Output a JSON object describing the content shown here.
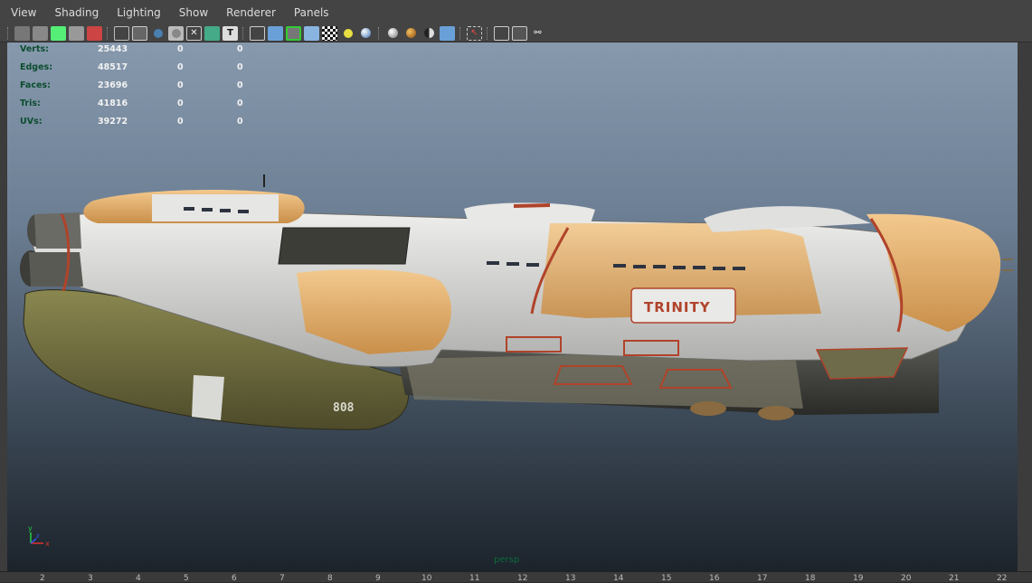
{
  "menu": [
    "View",
    "Shading",
    "Lighting",
    "Show",
    "Renderer",
    "Panels"
  ],
  "toolbar_icons": [
    "camera-icon",
    "camera-attributes-icon",
    "bookmark-icon",
    "image-plane-icon",
    "grease-pencil-icon",
    "wireframe-icon",
    "xray-grid-icon",
    "smooth-shade-icon",
    "flat-shade-icon",
    "bounding-box-icon",
    "texture-icon",
    "text-icon",
    "cube-wire-icon",
    "cube-shaded-icon",
    "cube-selected-icon",
    "cube-default-icon",
    "checker-icon",
    "light-icon",
    "sphere-icon",
    "shadow-icon",
    "ambient-occlusion-icon",
    "motion-blur-icon",
    "anti-alias-icon",
    "isolate-select-icon",
    "xray-icon",
    "xray-joints-icon",
    "component-icon"
  ],
  "hud": {
    "rows": [
      {
        "label": "Verts:",
        "v1": "25443",
        "v2": "0",
        "v3": "0"
      },
      {
        "label": "Edges:",
        "v1": "48517",
        "v2": "0",
        "v3": "0"
      },
      {
        "label": "Faces:",
        "v1": "23696",
        "v2": "0",
        "v3": "0"
      },
      {
        "label": "Tris:",
        "v1": "41816",
        "v2": "0",
        "v3": "0"
      },
      {
        "label": "UVs:",
        "v1": "39272",
        "v2": "0",
        "v3": "0"
      }
    ]
  },
  "model": {
    "logo_text": "TRINITY",
    "hull_number": "808"
  },
  "camera_label": "persp",
  "axis": {
    "y": "y",
    "x": "x",
    "z": "z"
  },
  "ruler": [
    "2",
    "3",
    "4",
    "5",
    "6",
    "7",
    "8",
    "9",
    "10",
    "11",
    "12",
    "13",
    "14",
    "15",
    "16",
    "17",
    "18",
    "19",
    "20",
    "21",
    "22"
  ],
  "colors": {
    "hull_white": "#d8d8d6",
    "hull_orange": "#e8b574",
    "hull_olive": "#6f6c3e",
    "accent_red": "#b0432a",
    "hud_label": "#0b4d2e"
  }
}
